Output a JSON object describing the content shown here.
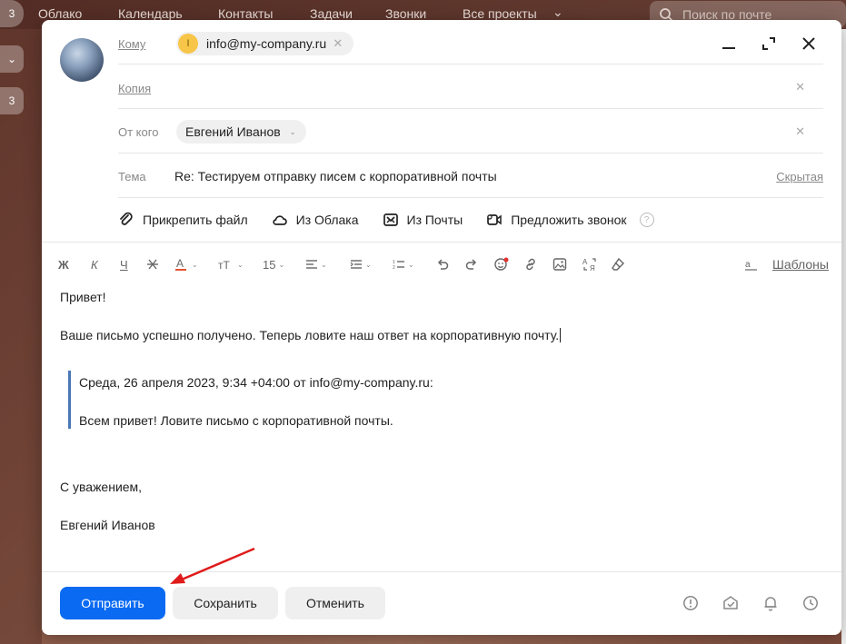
{
  "background": {
    "nav": [
      "Облако",
      "Календарь",
      "Контакты",
      "Задачи",
      "Звонки",
      "Все проекты"
    ],
    "search_placeholder": "Поиск по почте",
    "left_badges": [
      "3",
      "3"
    ]
  },
  "compose": {
    "to_label": "Кому",
    "to_recipient": {
      "letter": "I",
      "email": "info@my-company.ru"
    },
    "cc_label": "Копия",
    "from_label": "От кого",
    "from_value": "Евгений Иванов",
    "subject_label": "Тема",
    "subject_value": "Re: Тестируем отправку писем с корпоративной почты",
    "bcc_link": "Скрытая",
    "attach": {
      "file": "Прикрепить файл",
      "cloud": "Из Облака",
      "mail": "Из Почты",
      "call": "Предложить звонок"
    },
    "toolbar": {
      "bold": "Ж",
      "italic": "К",
      "underline": "Ч",
      "font_size": "15",
      "templates": "Шаблоны"
    },
    "body": {
      "greeting": "Привет!",
      "line1": "Ваше письмо успешно получено. Теперь ловите наш ответ на корпоративную почту.",
      "quote_header": "Среда, 26 апреля 2023, 9:34 +04:00 от info@my-company.ru:",
      "quote_body": "Всем привет! Ловите письмо с корпоративной почты.",
      "regards": "С уважением,",
      "signature": "Евгений Иванов"
    },
    "buttons": {
      "send": "Отправить",
      "save": "Сохранить",
      "cancel": "Отменить"
    }
  },
  "colors": {
    "primary": "#0a6af2",
    "quote_bar": "#4a78b5",
    "annotation_arrow": "#e01b1b",
    "avatar_letter_bg": "#f7c548"
  }
}
